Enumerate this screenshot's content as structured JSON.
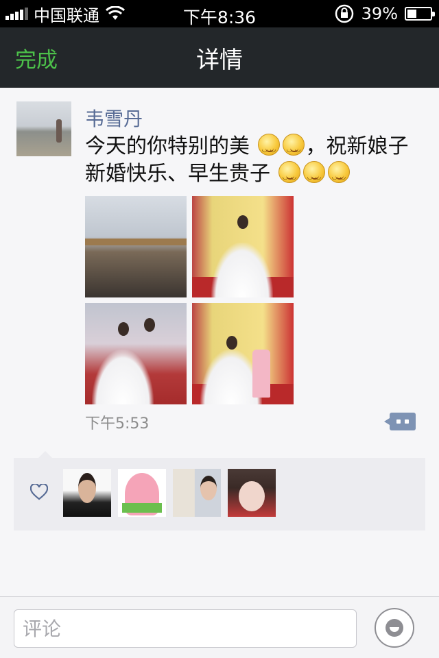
{
  "status_bar": {
    "carrier": "中国联通",
    "time": "下午8:36",
    "battery": "39%"
  },
  "nav": {
    "done_label": "完成",
    "title": "详情"
  },
  "post": {
    "author": "韦雪丹",
    "text_part1": "今天的你特别的美",
    "text_part2": "，祝新娘子新婚快乐、早生贵子",
    "time": "下午5:53"
  },
  "comment_bar": {
    "placeholder": "评论"
  },
  "colors": {
    "accent_green": "#4cc04a",
    "author_blue": "#576b95"
  }
}
